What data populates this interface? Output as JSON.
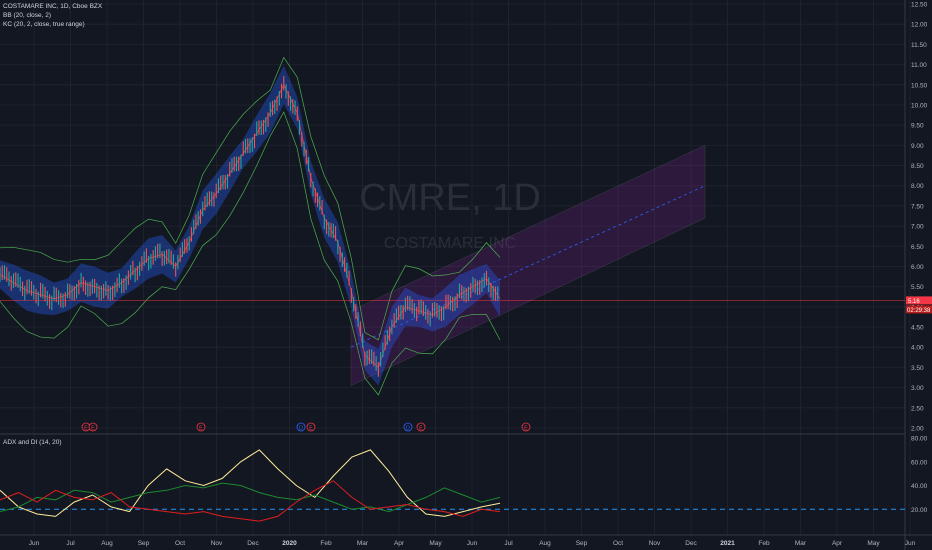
{
  "legend": {
    "symbol": "COSTAMARE INC, 1D, Cboe BZX",
    "bb": "BB (20, close, 2)",
    "kc": "KC (20, 2, close, true range)"
  },
  "indicator": {
    "title": "ADX and DI (14, 20)"
  },
  "watermark": {
    "ticker": "CMRE, 1D",
    "name": "COSTAMARE INC"
  },
  "price_badges": {
    "last": "5.16",
    "countdown": "02:29:38"
  },
  "events": [
    "E",
    "E",
    "E",
    "D",
    "E",
    "D",
    "E",
    "E"
  ],
  "chart_data": [
    {
      "type": "line",
      "title": "COSTAMARE INC, 1D, Cboe BZX",
      "x_ticks": [
        "Jun",
        "Jul",
        "Aug",
        "Sep",
        "Oct",
        "Nov",
        "Dec",
        "2020",
        "Feb",
        "Mar",
        "Apr",
        "May",
        "Jun",
        "Jul",
        "Aug",
        "Sep",
        "Oct",
        "Nov",
        "Dec",
        "2021",
        "Feb",
        "Mar",
        "Apr",
        "May",
        "Jun"
      ],
      "y_ticks": [
        "12.50",
        "12.00",
        "11.50",
        "11.00",
        "10.50",
        "10.00",
        "9.50",
        "9.00",
        "8.50",
        "8.00",
        "7.50",
        "7.00",
        "6.50",
        "6.00",
        "5.50",
        "5.00",
        "4.50",
        "4.00",
        "3.50",
        "3.00",
        "2.50",
        "2.00"
      ],
      "ylim": [
        2.0,
        12.5
      ],
      "series": [
        {
          "name": "CMRE",
          "values": [
            5.8,
            5.6,
            5.4,
            5.3,
            5.2,
            5.3,
            5.6,
            5.5,
            5.4,
            5.6,
            5.9,
            6.2,
            6.3,
            6.0,
            6.6,
            7.4,
            7.8,
            8.3,
            8.8,
            9.3,
            9.8,
            10.5,
            9.8,
            8.2,
            7.2,
            6.6,
            5.4,
            3.8,
            3.5,
            4.5,
            5.0,
            4.9,
            4.8,
            5.0,
            5.3,
            5.5,
            5.7,
            5.2
          ]
        }
      ],
      "channel": {
        "start": [
          3.6,
          4.9
        ],
        "mid": [
          6.0,
          8.0
        ],
        "end": [
          7.2,
          9.0
        ]
      },
      "grid": true
    },
    {
      "type": "line",
      "title": "ADX and DI (14, 20)",
      "y_ticks": [
        "80.00",
        "60.00",
        "40.00",
        "20.00"
      ],
      "ylim": [
        0,
        80
      ],
      "threshold": 20,
      "series": [
        {
          "name": "ADX",
          "values": [
            36,
            22,
            16,
            14,
            26,
            32,
            22,
            18,
            40,
            54,
            44,
            40,
            46,
            60,
            70,
            54,
            40,
            30,
            48,
            64,
            70,
            52,
            30,
            16,
            14,
            18,
            22,
            25
          ]
        },
        {
          "name": "+DI",
          "values": [
            18,
            22,
            30,
            28,
            36,
            34,
            26,
            30,
            34,
            36,
            40,
            38,
            42,
            40,
            34,
            30,
            28,
            32,
            26,
            20,
            22,
            18,
            24,
            30,
            38,
            32,
            26,
            30
          ]
        },
        {
          "name": "-DI",
          "values": [
            28,
            34,
            26,
            36,
            30,
            28,
            34,
            22,
            20,
            18,
            16,
            18,
            14,
            12,
            10,
            14,
            26,
            36,
            44,
            30,
            20,
            22,
            24,
            20,
            18,
            14,
            20,
            18
          ]
        }
      ]
    }
  ]
}
